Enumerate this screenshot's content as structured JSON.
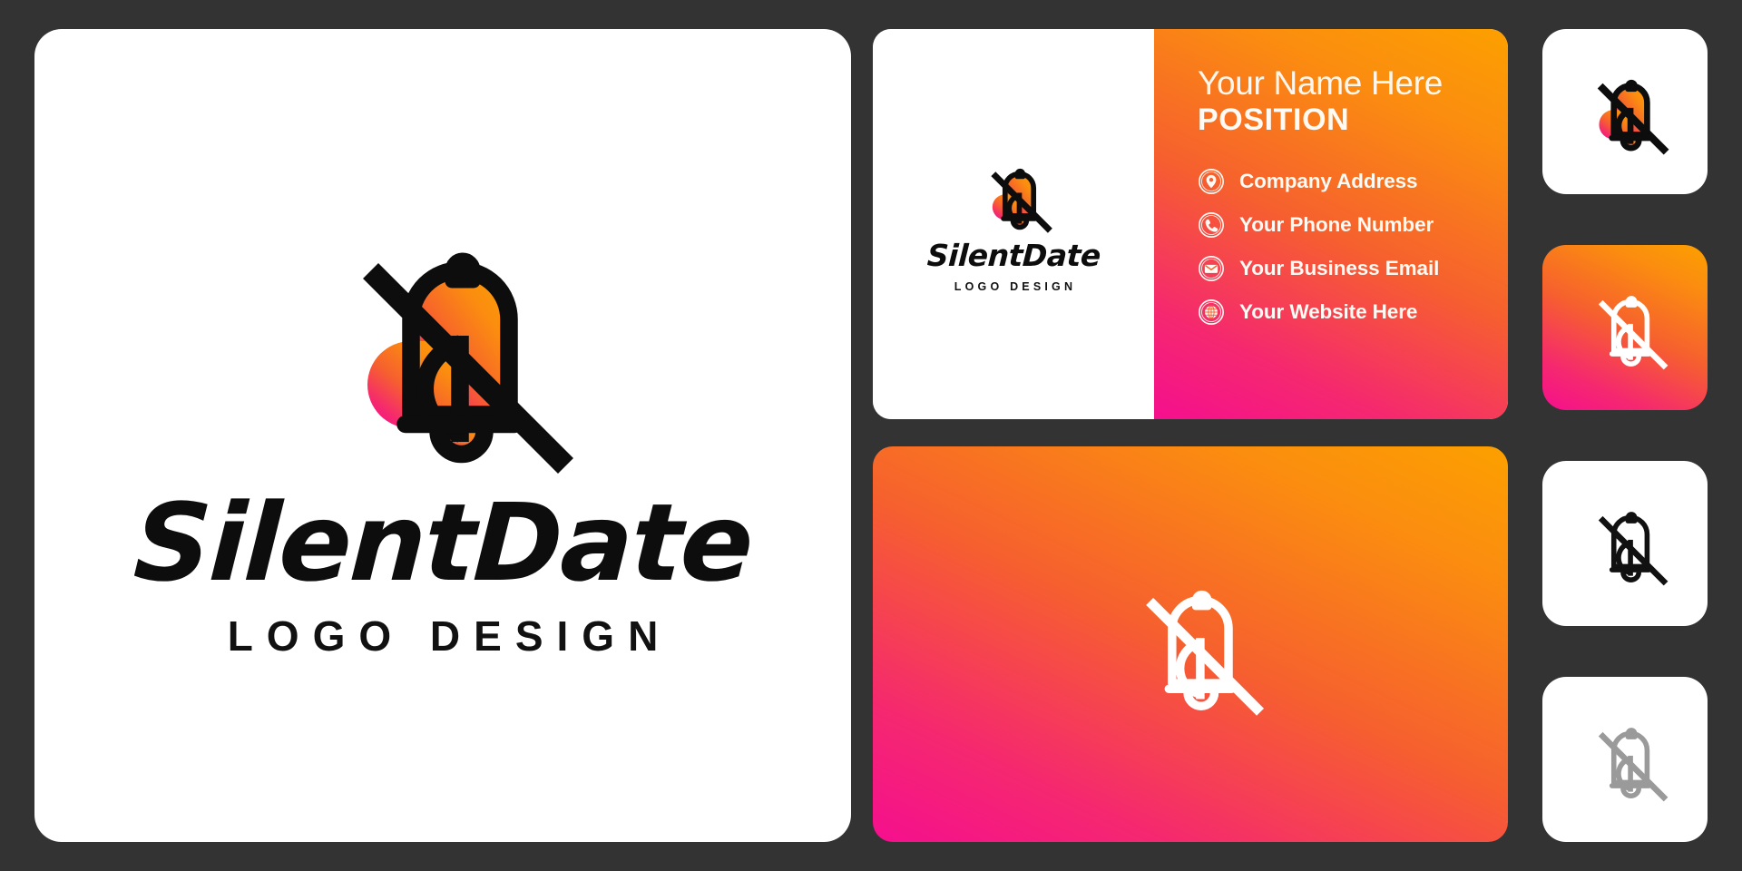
{
  "brand": {
    "name": "SilentDate",
    "tagline": "LOGO DESIGN",
    "mark_name": "bell-muted-heart-icon"
  },
  "theme": {
    "background": "#333333",
    "panel": "#ffffff",
    "gradient_start": "#fca000",
    "gradient_mid": "#f6602e",
    "gradient_end": "#f50f8e",
    "ink": "#0d0d0d",
    "gray_mark": "#9a9a9a"
  },
  "main_panel": {
    "wordmark": "SilentDate",
    "tagline": "LOGO DESIGN"
  },
  "business_card": {
    "left": {
      "wordmark": "SilentDate",
      "tagline": "LOGO DESIGN"
    },
    "right": {
      "name": "Your Name Here",
      "position": "POSITION",
      "contacts": [
        {
          "icon": "location-pin-icon",
          "label": "Company Address"
        },
        {
          "icon": "phone-icon",
          "label": "Your Phone Number"
        },
        {
          "icon": "envelope-icon",
          "label": "Your Business Email"
        },
        {
          "icon": "globe-icon",
          "label": "Your Website Here"
        }
      ]
    }
  },
  "showcase": {
    "mark_name": "bell-muted-heart-icon-white"
  },
  "variants": [
    {
      "style": "color-on-white",
      "background": "#ffffff",
      "mark": "bell-muted-heart-icon-color"
    },
    {
      "style": "white-on-gradient",
      "background": "gradient",
      "mark": "bell-muted-heart-icon-white"
    },
    {
      "style": "black-on-white",
      "background": "#ffffff",
      "mark": "bell-muted-heart-icon-black"
    },
    {
      "style": "gray-on-white",
      "background": "#ffffff",
      "mark": "bell-muted-heart-icon-gray"
    }
  ]
}
